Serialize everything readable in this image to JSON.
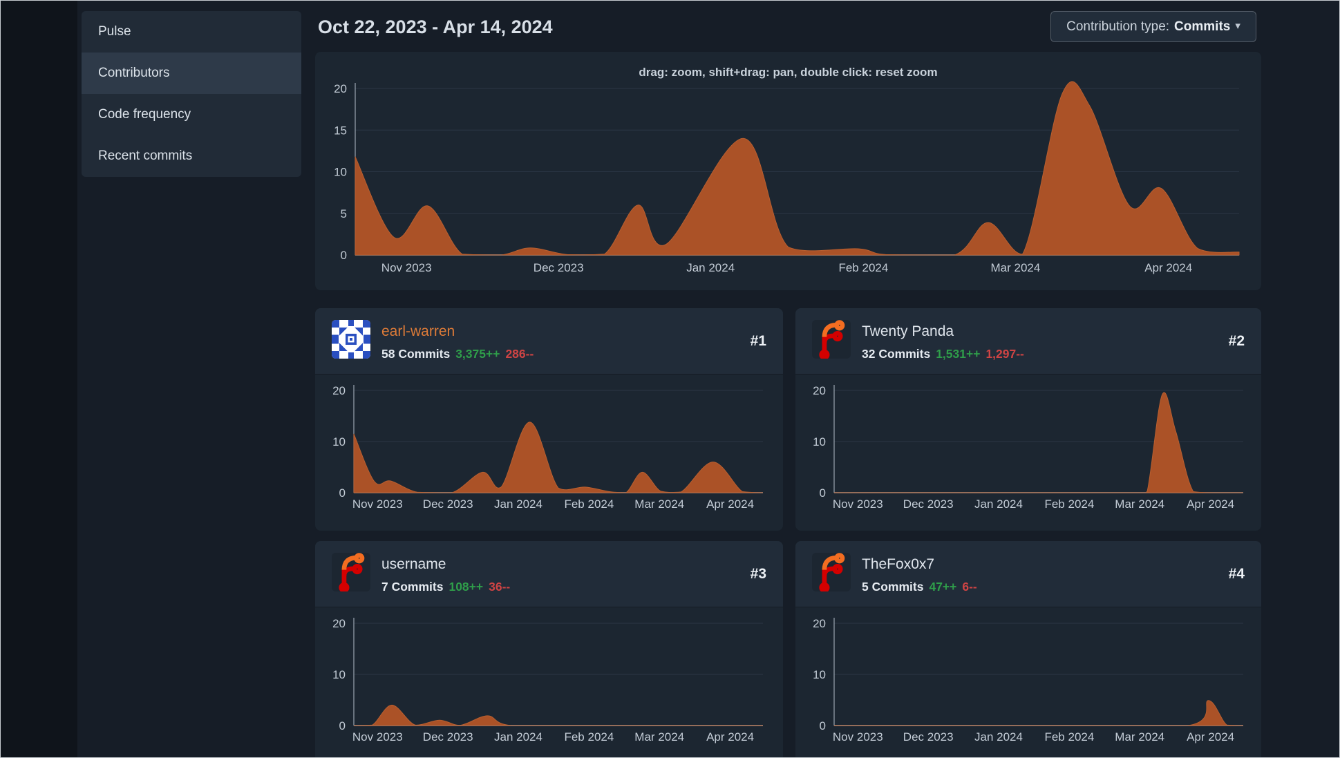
{
  "sidebar": {
    "items": [
      {
        "label": "Pulse",
        "active": false
      },
      {
        "label": "Contributors",
        "active": true
      },
      {
        "label": "Code frequency",
        "active": false
      },
      {
        "label": "Recent commits",
        "active": false
      }
    ]
  },
  "header": {
    "date_range": "Oct 22, 2023 - Apr 14, 2024",
    "contribution_type_label": "Contribution type:",
    "contribution_type_value": "Commits"
  },
  "months": [
    "Nov 2023",
    "Dec 2023",
    "Jan 2024",
    "Feb 2024",
    "Mar 2024",
    "Apr 2024"
  ],
  "month_fracs": [
    0.058,
    0.23,
    0.402,
    0.575,
    0.747,
    0.92
  ],
  "colors": {
    "page_bg": "#0f141b",
    "content_bg": "#161d27",
    "panel_bg": "#212b37",
    "panel_active_bg": "#2e3a49",
    "card_bg": "#1c2631",
    "area_fill": "#ab5227",
    "area_stroke": "#b85f30",
    "accent_link": "#dd7b38",
    "additions_green": "#2f9e4a",
    "deletions_red": "#cf4444",
    "grid_line": "#2b3645",
    "axis_line": "#c9d1d9",
    "axis_text": "#c2cbd5"
  },
  "chart_data": [
    {
      "type": "area",
      "title": "repository commit activity per week",
      "hint": "drag: zoom, shift+drag: pan, double click: reset zoom",
      "ylim": [
        0,
        20
      ],
      "y_ticks": [
        0,
        5,
        10,
        15,
        20
      ],
      "x_range": [
        "Oct 22, 2023",
        "Apr 14, 2024"
      ],
      "points": [
        [
          0,
          11.8
        ],
        [
          0.044,
          2.1
        ],
        [
          0.082,
          5.9
        ],
        [
          0.121,
          0.1
        ],
        [
          0.165,
          0
        ],
        [
          0.198,
          0.85
        ],
        [
          0.24,
          0.05
        ],
        [
          0.282,
          0.1
        ],
        [
          0.32,
          6
        ],
        [
          0.352,
          1.3
        ],
        [
          0.439,
          14
        ],
        [
          0.49,
          0.95
        ],
        [
          0.569,
          0.75
        ],
        [
          0.6,
          0.05
        ],
        [
          0.678,
          0
        ],
        [
          0.716,
          3.9
        ],
        [
          0.755,
          0.1
        ],
        [
          0.8,
          19.4
        ],
        [
          0.831,
          17.9
        ],
        [
          0.876,
          5.9
        ],
        [
          0.912,
          8
        ],
        [
          0.953,
          0.8
        ],
        [
          1,
          0.35
        ]
      ]
    },
    {
      "type": "area",
      "title": "earl-warren commits per week",
      "ylim": [
        0,
        20
      ],
      "y_ticks": [
        0,
        10,
        20
      ],
      "points": [
        [
          0,
          11.5
        ],
        [
          0.05,
          2.2
        ],
        [
          0.09,
          2.3
        ],
        [
          0.155,
          0.1
        ],
        [
          0.24,
          0
        ],
        [
          0.315,
          4
        ],
        [
          0.36,
          1.1
        ],
        [
          0.43,
          13.8
        ],
        [
          0.5,
          0.9
        ],
        [
          0.565,
          1.1
        ],
        [
          0.625,
          0.2
        ],
        [
          0.665,
          0
        ],
        [
          0.705,
          4
        ],
        [
          0.75,
          0.3
        ],
        [
          0.8,
          0.15
        ],
        [
          0.878,
          6
        ],
        [
          0.95,
          0.2
        ],
        [
          1,
          0
        ]
      ]
    },
    {
      "type": "area",
      "title": "Twenty Panda commits per week",
      "ylim": [
        0,
        20
      ],
      "y_ticks": [
        0,
        10,
        20
      ],
      "points": [
        [
          0,
          0
        ],
        [
          0.4,
          0
        ],
        [
          0.74,
          0
        ],
        [
          0.765,
          0.2
        ],
        [
          0.802,
          19.2
        ],
        [
          0.835,
          12
        ],
        [
          0.878,
          0.2
        ],
        [
          0.93,
          0
        ],
        [
          1,
          0
        ]
      ]
    },
    {
      "type": "area",
      "title": "username commits per week",
      "ylim": [
        0,
        20
      ],
      "y_ticks": [
        0,
        10,
        20
      ],
      "points": [
        [
          0,
          0
        ],
        [
          0.045,
          0.1
        ],
        [
          0.093,
          4
        ],
        [
          0.15,
          0.1
        ],
        [
          0.21,
          1.05
        ],
        [
          0.26,
          0.05
        ],
        [
          0.327,
          1.9
        ],
        [
          0.385,
          0
        ],
        [
          0.6,
          0
        ],
        [
          1,
          0
        ]
      ]
    },
    {
      "type": "area",
      "title": "TheFox0x7 commits per week",
      "ylim": [
        0,
        20
      ],
      "y_ticks": [
        0,
        10,
        20
      ],
      "points": [
        [
          0,
          0
        ],
        [
          0.5,
          0
        ],
        [
          0.865,
          0
        ],
        [
          0.915,
          4.9
        ],
        [
          0.96,
          0.1
        ],
        [
          1,
          0
        ]
      ]
    }
  ],
  "contributors": [
    {
      "rank": "#1",
      "name": "earl-warren",
      "commits": "58 Commits",
      "additions": "3,375++",
      "deletions": "286--",
      "avatar": "identicon",
      "is_link": true,
      "chart": 1
    },
    {
      "rank": "#2",
      "name": "Twenty Panda",
      "commits": "32 Commits",
      "additions": "1,531++",
      "deletions": "1,297--",
      "avatar": "forgejo-logo",
      "is_link": false,
      "chart": 2
    },
    {
      "rank": "#3",
      "name": "username",
      "commits": "7 Commits",
      "additions": "108++",
      "deletions": "36--",
      "avatar": "forgejo-logo",
      "is_link": false,
      "chart": 3
    },
    {
      "rank": "#4",
      "name": "TheFox0x7",
      "commits": "5 Commits",
      "additions": "47++",
      "deletions": "6--",
      "avatar": "forgejo-logo",
      "is_link": false,
      "chart": 4
    }
  ]
}
